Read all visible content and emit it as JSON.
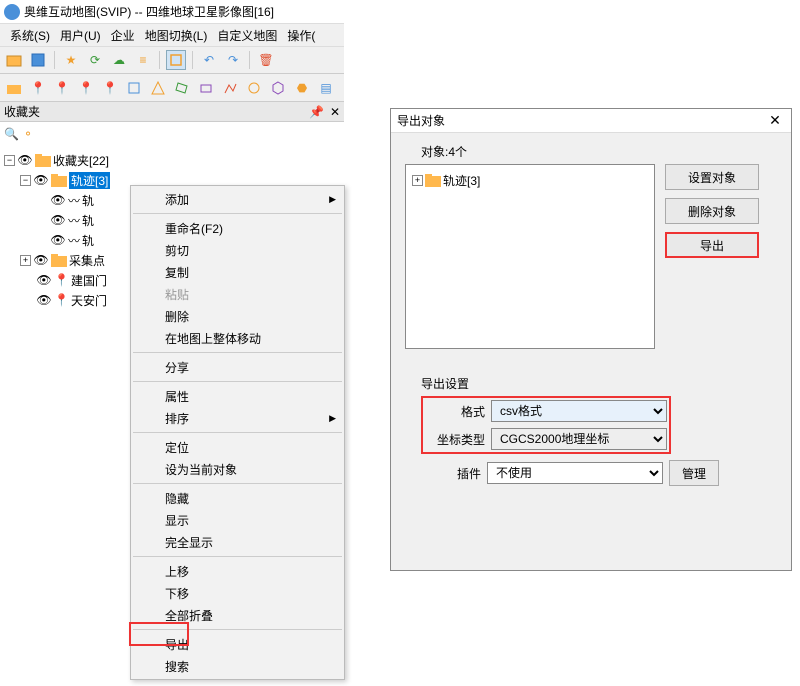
{
  "title": "奥维互动地图(SVIP) -- 四维地球卫星影像图[16]",
  "menus": [
    "系统(S)",
    "用户(U)",
    "企业",
    "地图切换(L)",
    "自定义地图",
    "操作("
  ],
  "panel": {
    "title": "收藏夹"
  },
  "tree": {
    "root": "收藏夹[22]",
    "sel": "轨迹[3]",
    "c1": "轨",
    "c2": "轨",
    "c3": "轨",
    "sib1": "采集点",
    "sib2": "建国门",
    "sib3": "天安门"
  },
  "cm": {
    "add": "添加",
    "rename": "重命名(F2)",
    "cut": "剪切",
    "copy": "复制",
    "paste": "粘贴",
    "delete": "删除",
    "moveonmap": "在地图上整体移动",
    "share": "分享",
    "props": "属性",
    "sort": "排序",
    "locate": "定位",
    "setcurrent": "设为当前对象",
    "hide": "隐藏",
    "show": "显示",
    "showall": "完全显示",
    "moveup": "上移",
    "movedown": "下移",
    "collapseall": "全部折叠",
    "export": "导出",
    "search": "搜索"
  },
  "dlg": {
    "title": "导出对象",
    "objlabel": "对象:4个",
    "treeitem": "轨迹[3]",
    "btn_setobj": "设置对象",
    "btn_delobj": "删除对象",
    "btn_export": "导出",
    "settings_label": "导出设置",
    "fmt_label": "格式",
    "fmt_value": "csv格式",
    "coord_label": "坐标类型",
    "coord_value": "CGCS2000地理坐标",
    "plugin_label": "插件",
    "plugin_value": "不使用",
    "btn_manage": "管理"
  }
}
